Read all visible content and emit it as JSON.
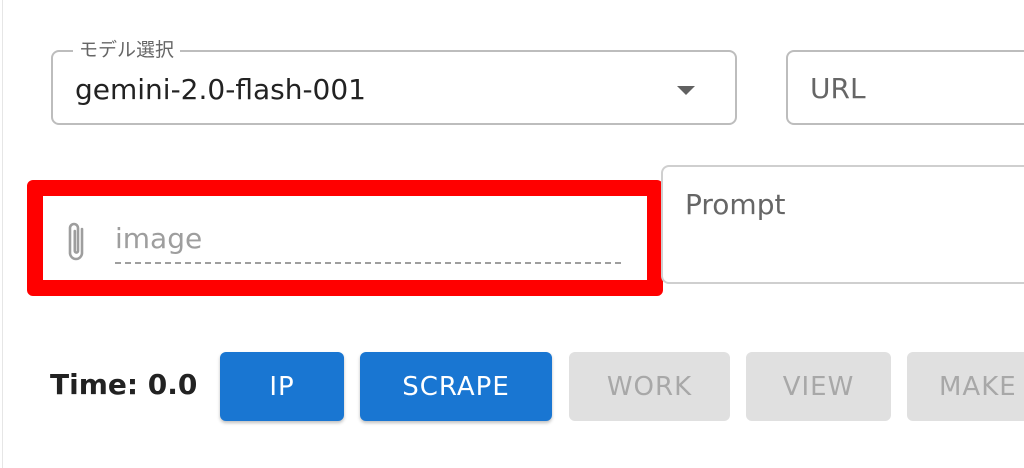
{
  "model_select": {
    "label": "モデル選択",
    "value": "gemini-2.0-flash-001"
  },
  "url_field": {
    "placeholder": "URL"
  },
  "image_input": {
    "placeholder": "image",
    "icon": "paperclip-icon",
    "highlight_color": "#ff0000"
  },
  "prompt_field": {
    "placeholder": "Prompt"
  },
  "time_label": "Time: 0.0",
  "buttons": {
    "ip": "IP",
    "scrape": "SCRAPE",
    "work": "WORK",
    "view": "VIEW",
    "make": "MAKE"
  },
  "colors": {
    "primary": "#1976d2",
    "disabled_bg": "#e0e0e0",
    "disabled_text": "#a8a8a8"
  }
}
